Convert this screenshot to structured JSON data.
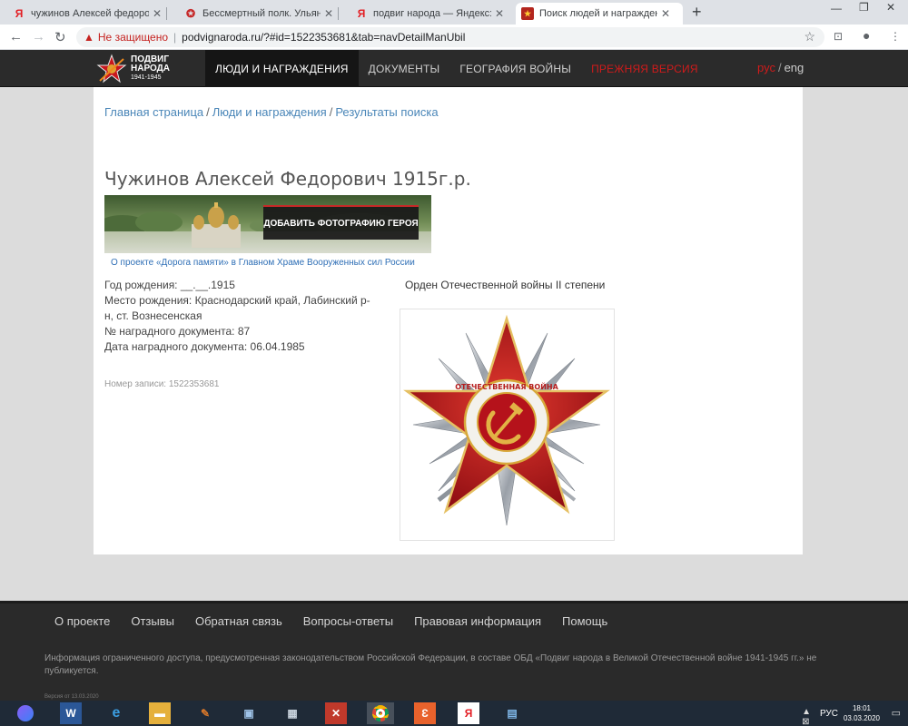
{
  "browser": {
    "tabs": [
      {
        "title": "чужинов Алексей федорович —",
        "icon": "yandex-icon"
      },
      {
        "title": "Бессмертный полк. Ульяновск. С",
        "icon": "star-icon"
      },
      {
        "title": "подвиг народа — Яндекс: нашл",
        "icon": "yandex-icon"
      },
      {
        "title": "Поиск людей и награждения",
        "icon": "podvig-icon"
      }
    ],
    "new_tab": "+",
    "address": {
      "security_label": "Не защищено",
      "url": "podvignaroda.ru/?#id=1522353681&tab=navDetailManUbil"
    }
  },
  "site": {
    "logo": {
      "line1": "ПОДВИГ",
      "line2": "НАРОДА",
      "years": "1941-1945"
    },
    "menu": [
      "ЛЮДИ И НАГРАЖДЕНИЯ",
      "ДОКУМЕНТЫ",
      "ГЕОГРАФИЯ ВОЙНЫ",
      "ПРЕЖНЯЯ ВЕРСИЯ"
    ],
    "lang": {
      "ru": "рус",
      "sep": "/",
      "en": "eng"
    }
  },
  "breadcrumb": [
    "Главная страница",
    "Люди и награждения",
    "Результаты поиска"
  ],
  "breadcrumb_sep": "/",
  "person": {
    "name": "Чужинов Алексей Федорович 1915г.р.",
    "banner_button": "ДОБАВИТЬ ФОТОГРАФИЮ ГЕРОЯ",
    "banner_caption": "О проекте «Дорога памяти» в Главном Храме Вооруженных сил России",
    "birth_year": "Год рождения: __.__.1915",
    "birth_place": "Место рождения: Краснодарский край, Лабинский р-н, ст. Вознесенская",
    "doc_number": "№ наградного документа: 87",
    "doc_date": "Дата наградного документа: 06.04.1985",
    "record_number": "Номер записи: 1522353681"
  },
  "award": {
    "title": "Орден Отечественной войны II степени",
    "medal_text": "ОТЕЧЕСТВЕННАЯ ВОЙНА",
    "colors": {
      "red": "#c8171e",
      "silver": "#b9bec4",
      "gold": "#d8a83a"
    }
  },
  "footer": {
    "nav": [
      "О проекте",
      "Отзывы",
      "Обратная связь",
      "Вопросы-ответы",
      "Правовая информация",
      "Помощь"
    ],
    "note": "Информация ограниченного доступа, предусмотренная законодательством Российской Федерации, в составе ОБД «Подвиг народа в Великой Отечественной войне 1941-1945 гг.» не публикуется.",
    "version": "Версия от 13.03.2020"
  },
  "taskbar": {
    "lang": "РУС",
    "time": "18:01",
    "date": "03.03.2020"
  }
}
